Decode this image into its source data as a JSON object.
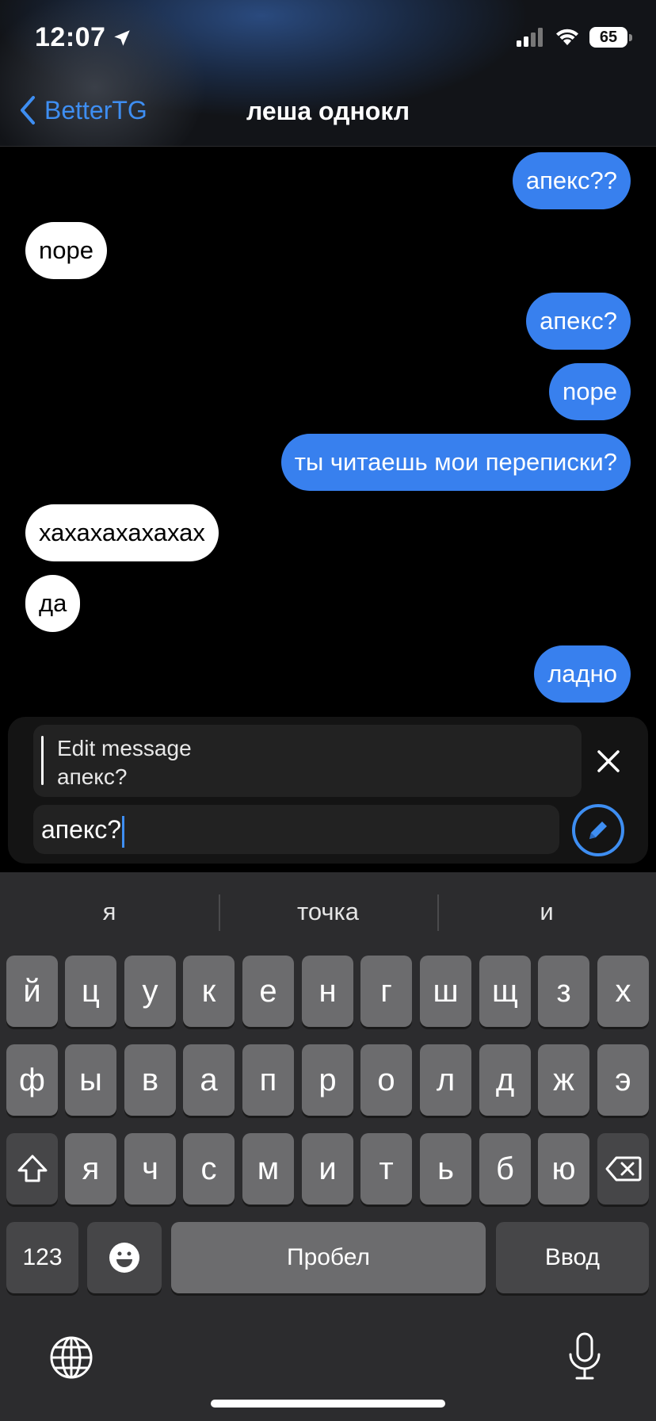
{
  "status_bar": {
    "time": "12:07",
    "battery": "65",
    "location_icon": "location-arrow-icon",
    "signal_icon": "signal-icon",
    "wifi_icon": "wifi-icon"
  },
  "nav": {
    "back_label": "BetterTG",
    "title": "леша однокл"
  },
  "messages": [
    {
      "dir": "out",
      "text": "апекс??"
    },
    {
      "dir": "in",
      "text": "nope"
    },
    {
      "dir": "out",
      "text": "апекс?"
    },
    {
      "dir": "out",
      "text": "nope"
    },
    {
      "dir": "out",
      "text": "ты читаешь мои переписки?"
    },
    {
      "dir": "in",
      "text": "хахахахахахах"
    },
    {
      "dir": "in",
      "text": "да"
    },
    {
      "dir": "out",
      "text": "ладно"
    }
  ],
  "composer": {
    "edit_label": "Edit message",
    "edit_original": "апекс?",
    "input_value": "апекс?"
  },
  "keyboard": {
    "suggestions": [
      "я",
      "точка",
      "и"
    ],
    "row1": [
      "й",
      "ц",
      "у",
      "к",
      "е",
      "н",
      "г",
      "ш",
      "щ",
      "з",
      "х"
    ],
    "row2": [
      "ф",
      "ы",
      "в",
      "а",
      "п",
      "р",
      "о",
      "л",
      "д",
      "ж",
      "э"
    ],
    "row3": [
      "я",
      "ч",
      "с",
      "м",
      "и",
      "т",
      "ь",
      "б",
      "ю"
    ],
    "numbers_label": "123",
    "space_label": "Пробел",
    "return_label": "Ввод"
  },
  "colors": {
    "accent": "#3e8ef2",
    "outgoing_bubble": "#3880ee",
    "incoming_bubble": "#ffffff",
    "keyboard_bg": "#2c2c2e"
  }
}
